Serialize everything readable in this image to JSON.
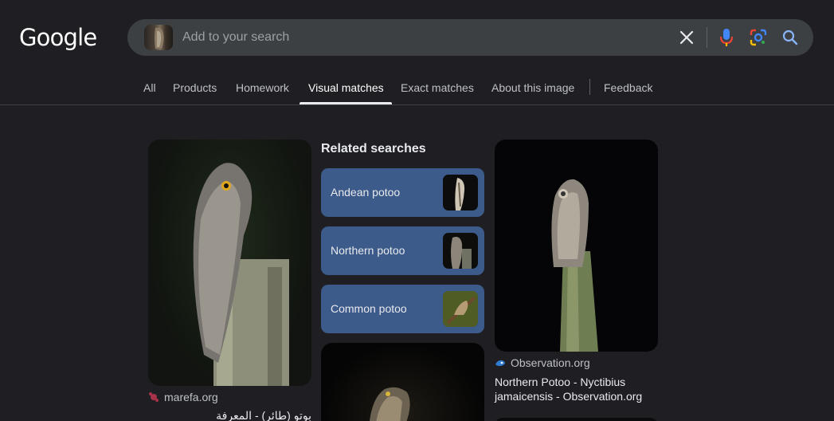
{
  "logo": {
    "text": "Google"
  },
  "search": {
    "placeholder": "Add to your search",
    "value": ""
  },
  "tabs": [
    {
      "label": "All"
    },
    {
      "label": "Products"
    },
    {
      "label": "Homework"
    },
    {
      "label": "Visual matches",
      "active": true
    },
    {
      "label": "Exact matches"
    },
    {
      "label": "About this image"
    },
    {
      "label": "Feedback"
    }
  ],
  "results": [
    {
      "source": "marefa.org",
      "title": "بوتو (طائر) - المعرفة",
      "favicon": "marefa-favicon"
    },
    {
      "source": "Observation.org",
      "title": "Northern Potoo - Nyctibius jamaicensis - Observation.org",
      "favicon": "observation-favicon"
    }
  ],
  "related": {
    "heading": "Related searches",
    "items": [
      {
        "label": "Andean potoo"
      },
      {
        "label": "Northern potoo"
      },
      {
        "label": "Common potoo"
      }
    ]
  },
  "colors": {
    "background": "#1f1f23",
    "searchbar": "#3c4043",
    "chip": "#3c5a8a",
    "mic_blue": "#4285f4",
    "mic_red": "#ea4335",
    "lens_yellow": "#fbbc04",
    "lens_green": "#34a853"
  }
}
